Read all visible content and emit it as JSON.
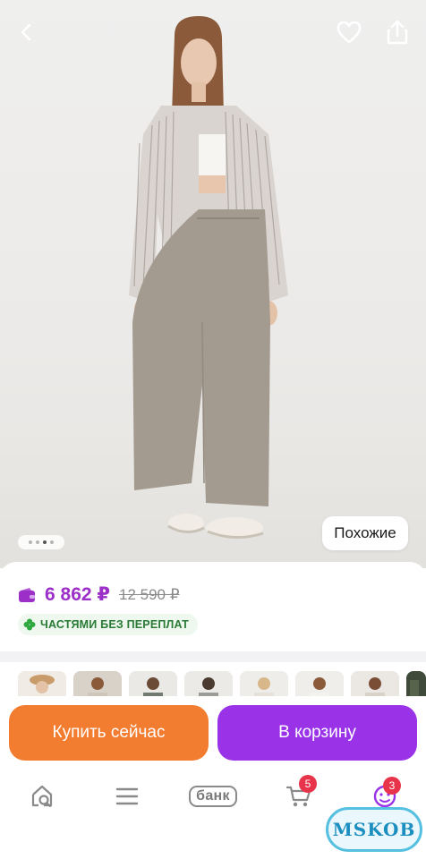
{
  "header": {
    "back_icon": "chevron-left-icon",
    "favorite_icon": "heart-outline-icon",
    "share_icon": "share-icon"
  },
  "gallery": {
    "image_subject": "woman in striped shirt and wide-leg trousers",
    "current_slide": 3,
    "total_slides": 4,
    "similar_label": "Похожие"
  },
  "price": {
    "current": "6 862 ₽",
    "old": "12 590 ₽",
    "current_color": "#9b2fc7",
    "installment_label": "ЧАСТЯМИ БЕЗ ПЕРЕПЛАТ",
    "installment_color": "#2a7a35"
  },
  "thumbnails": {
    "count_visible": 8
  },
  "actions": {
    "buy_now_label": "Купить сейчас",
    "buy_now_color": "#f27c2f",
    "add_to_cart_label": "В корзину",
    "add_to_cart_color": "#9a33e8"
  },
  "bottom_nav": {
    "home_icon": "home-search-icon",
    "menu_icon": "menu-icon",
    "bank_label": "банк",
    "cart_icon": "cart-icon",
    "cart_badge": "5",
    "profile_icon": "profile-icon",
    "profile_badge": "3"
  },
  "watermark": {
    "text": "MSKOB"
  }
}
